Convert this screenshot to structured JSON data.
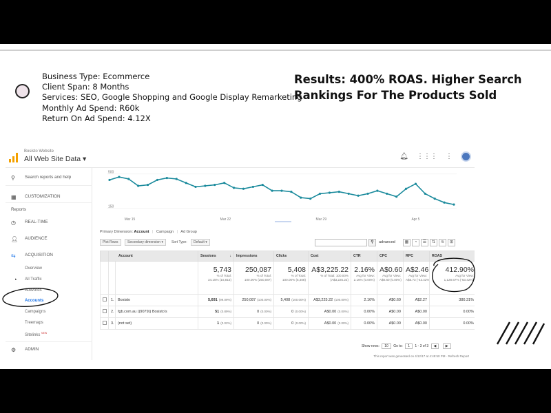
{
  "slide": {
    "details": [
      "Business Type: Ecommerce",
      "Client Span: 8 Months",
      "Services: SEO, Google Shopping and Google Display Remarketing",
      "Monthly Ad Spend: R60k",
      "Return On Ad Spend: 4.12X"
    ],
    "headline_line1": "Results: 400% ROAS. Higher Search",
    "headline_line2": "Rankings For The Products Sold"
  },
  "ga": {
    "account_name": "Bosisto Website",
    "property_view": "All Web Site Data ▾",
    "header_icons": [
      "bell-icon",
      "apps-icon",
      "more-icon",
      "avatar"
    ],
    "sidebar": {
      "search": "Search reports and help",
      "customization": "CUSTOMIZATION",
      "reports_heading": "Reports",
      "realtime": "REAL-TIME",
      "audience": "AUDIENCE",
      "acquisition": "ACQUISITION",
      "overview": "Overview",
      "all_traffic": "All Traffic",
      "adwords": "AdWords",
      "accounts": "Accounts",
      "campaigns": "Campaigns",
      "treemaps": "Treemaps",
      "sitelinks": "Sitelinks",
      "sitelinks_badge": "NEW",
      "admin": "ADMIN"
    },
    "chart_data": {
      "type": "line",
      "y_ticks": [
        "500",
        "150"
      ],
      "x_labels": [
        "Mar 15",
        "Mar 22",
        "Mar 29",
        "Apr 5"
      ],
      "series": [
        {
          "color": "#1a8a9c",
          "values": [
            440,
            470,
            450,
            380,
            390,
            440,
            460,
            450,
            410,
            370,
            380,
            390,
            410,
            360,
            350,
            370,
            390,
            330,
            330,
            320,
            260,
            250,
            300,
            310,
            320,
            300,
            280,
            300,
            330,
            300,
            270,
            350,
            400,
            300,
            250,
            210,
            190
          ]
        }
      ],
      "ylim": [
        100,
        520
      ]
    },
    "primary_dimension_label": "Primary Dimension:",
    "dimensions": [
      "Account",
      "Campaign",
      "Ad Group"
    ],
    "toolbar": {
      "plot_rows": "Plot Rows",
      "secondary_dimension": "Secondary dimension ▾",
      "sort_type_label": "Sort Type:",
      "sort_type_value": "Default ▾",
      "advanced": "advanced"
    },
    "table": {
      "headers": [
        "Account",
        "Sessions",
        "Impressions",
        "Clicks",
        "Cost",
        "CTR",
        "CPC",
        "RPC",
        "ROAS"
      ],
      "totals": [
        {
          "value": "5,743",
          "sub1": "% of Total:",
          "sub2": "34.15% (16,815)"
        },
        {
          "value": "250,087",
          "sub1": "% of Total:",
          "sub2": "100.00% (250,087)"
        },
        {
          "value": "5,408",
          "sub1": "% of Total:",
          "sub2": "100.00% (5,408)"
        },
        {
          "value": "A$3,225.22",
          "sub1": "% of Total: 100.00%",
          "sub2": "(A$3,225.22)"
        },
        {
          "value": "2.16%",
          "sub1": "Avg for View:",
          "sub2": "2.16% (0.00%)"
        },
        {
          "value": "A$0.60",
          "sub1": "Avg for View:",
          "sub2": "A$0.60 (0.00%)"
        },
        {
          "value": "A$2.46",
          "sub1": "Avg for View:",
          "sub2": "A$5.73 (-43.42%)"
        },
        {
          "value": "412.90%",
          "sub1": "Avg for View:",
          "sub2": "1,128.67% (-63.42%)"
        }
      ],
      "rows": [
        {
          "idx": "1.",
          "account": "Bosisto",
          "sessions": "5,691",
          "sessions_pct": "(99.09%)",
          "impressions": "250,087",
          "impressions_pct": "(100.00%)",
          "clicks": "5,408",
          "clicks_pct": "(100.00%)",
          "cost": "A$3,225.22",
          "cost_pct": "(100.00%)",
          "ctr": "2.16%",
          "cpc": "A$0.60",
          "rpc": "A$2.27",
          "roas": "380.31%"
        },
        {
          "idx": "2.",
          "account": "fgb.com.au ((9079)) Bosisto's",
          "sessions": "51",
          "sessions_pct": "(0.89%)",
          "impressions": "0",
          "impressions_pct": "(0.00%)",
          "clicks": "0",
          "clicks_pct": "(0.00%)",
          "cost": "A$0.00",
          "cost_pct": "(0.00%)",
          "ctr": "0.00%",
          "cpc": "A$0.00",
          "rpc": "A$0.00",
          "roas": "0.00%"
        },
        {
          "idx": "3.",
          "account": "(not set)",
          "sessions": "1",
          "sessions_pct": "(0.02%)",
          "impressions": "0",
          "impressions_pct": "(0.00%)",
          "clicks": "0",
          "clicks_pct": "(0.00%)",
          "cost": "A$0.00",
          "cost_pct": "(0.00%)",
          "ctr": "0.00%",
          "cpc": "A$0.00",
          "rpc": "A$0.00",
          "roas": "0.00%"
        }
      ]
    },
    "pager": {
      "show_rows_label": "Show rows:",
      "show_rows_value": "10",
      "goto_label": "Go to:",
      "goto_value": "1",
      "range": "1 - 3 of 3"
    },
    "report_note": "This report was generated on 4/12/17 at 4:49:50 PM · Refresh Report"
  }
}
